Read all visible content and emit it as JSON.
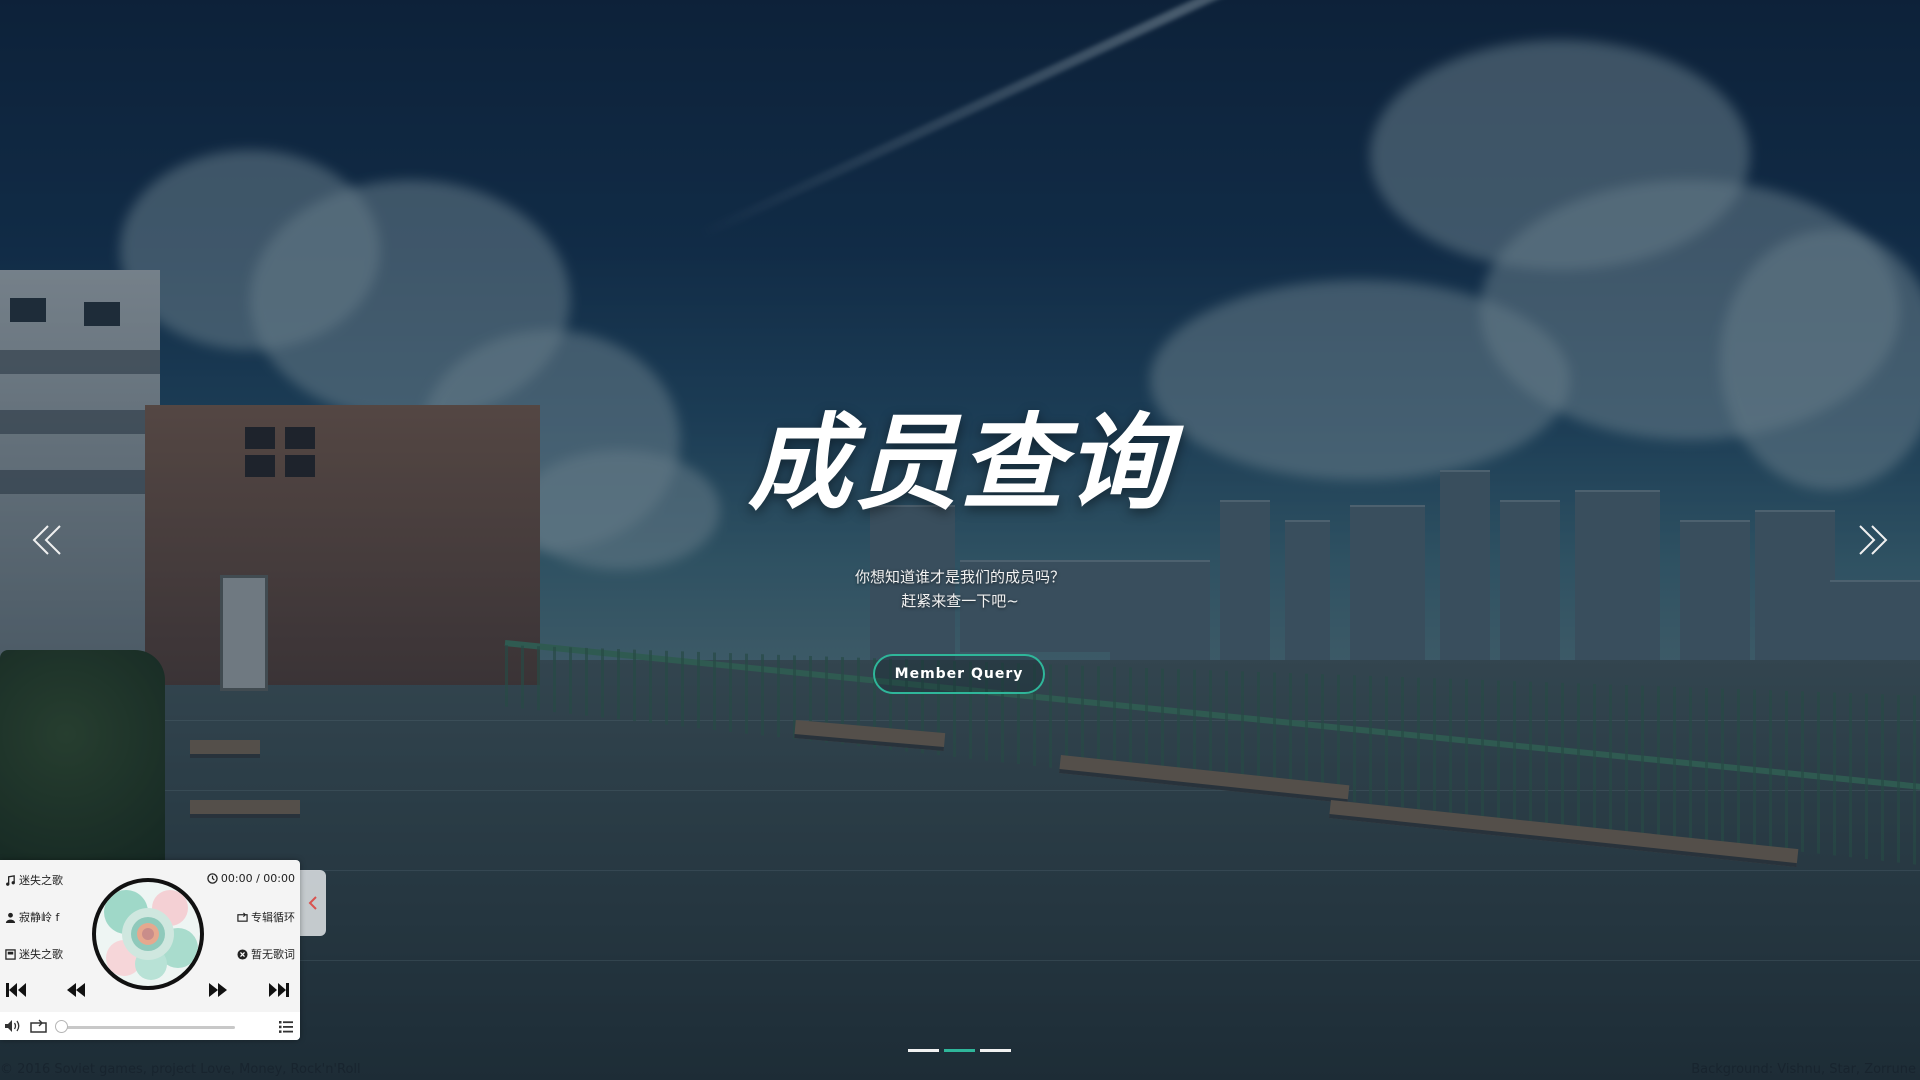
{
  "hero": {
    "title": "成员查询",
    "line1": "你想知道谁才是我们的成员吗？",
    "line2": "赶紧来查一下吧~",
    "cta_label": "Member Query"
  },
  "carousel": {
    "prev_icon": "chevron-double-left-icon",
    "next_icon": "chevron-double-right-icon",
    "indicators": 3,
    "active_index": 1
  },
  "footer": {
    "left": "© 2016 Soviet games, project Love, Money, Rock'n'Roll",
    "right": "Background: Vishnu, Star, Zorrune"
  },
  "player": {
    "song": "迷失之歌",
    "artist": "寂静岭 f",
    "album": "迷失之歌",
    "time": "00:00 / 00:00",
    "loop_mode": "专辑循环",
    "lyrics": "暂无歌词",
    "progress": 0
  },
  "colors": {
    "accent": "#2fb69a",
    "overlay": "#0a1928"
  }
}
